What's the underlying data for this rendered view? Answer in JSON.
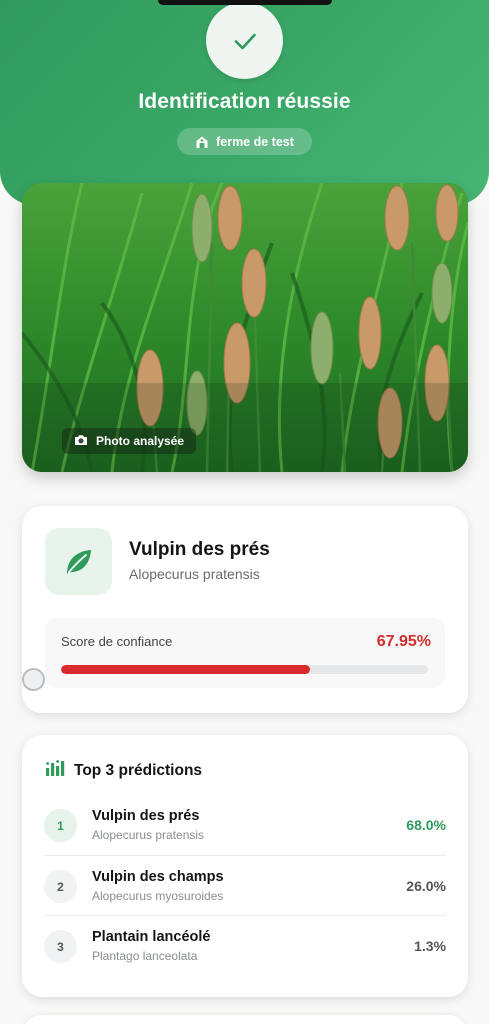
{
  "header": {
    "title": "Identification réussie",
    "farm": "ferme de test",
    "icons": {
      "status": "check-icon",
      "farm": "barn-icon"
    },
    "accent": "#3aa867"
  },
  "photo": {
    "label": "Photo analysée",
    "icon": "camera-icon"
  },
  "result": {
    "common_name": "Vulpin des prés",
    "latin_name": "Alopecurus pratensis",
    "icon": "leaf-icon",
    "confidence_label": "Score de confiance",
    "confidence_value": "67.95%",
    "confidence_fraction": 0.6795,
    "confidence_color": "#d92b2b"
  },
  "predictions": {
    "title": "Top 3 prédictions",
    "icon": "bar-chart-icon",
    "items": [
      {
        "rank": "1",
        "name": "Vulpin des prés",
        "latin": "Alopecurus pratensis",
        "pct": "68.0%"
      },
      {
        "rank": "2",
        "name": "Vulpin des champs",
        "latin": "Alopecurus myosuroides",
        "pct": "26.0%"
      },
      {
        "rank": "3",
        "name": "Plantain lancéolé",
        "latin": "Plantago lanceolata",
        "pct": "1.3%"
      }
    ]
  }
}
